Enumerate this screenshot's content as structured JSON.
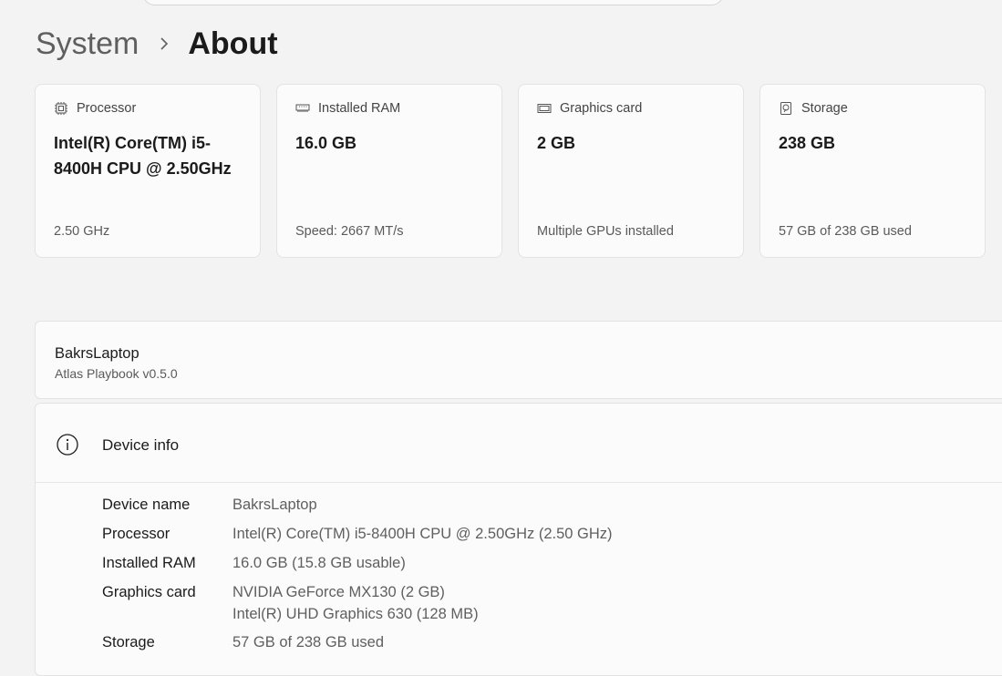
{
  "breadcrumb": {
    "parent": "System",
    "current": "About"
  },
  "cards": [
    {
      "label": "Processor",
      "value": "Intel(R) Core(TM) i5-8400H CPU @ 2.50GHz",
      "sub": "2.50 GHz",
      "icon": "processor-icon"
    },
    {
      "label": "Installed RAM",
      "value": "16.0 GB",
      "sub": "Speed: 2667 MT/s",
      "icon": "ram-icon"
    },
    {
      "label": "Graphics card",
      "value": "2 GB",
      "sub": "Multiple GPUs installed",
      "icon": "graphics-card-icon"
    },
    {
      "label": "Storage",
      "value": "238 GB",
      "sub": "57 GB of 238 GB used",
      "icon": "storage-icon"
    }
  ],
  "device": {
    "name": "BakrsLaptop",
    "edition": "Atlas Playbook v0.5.0"
  },
  "device_info": {
    "title": "Device info",
    "icon": "info-icon",
    "rows": [
      {
        "key": "Device name",
        "values": [
          "BakrsLaptop"
        ]
      },
      {
        "key": "Processor",
        "values": [
          "Intel(R) Core(TM) i5-8400H CPU @ 2.50GHz (2.50 GHz)"
        ]
      },
      {
        "key": "Installed RAM",
        "values": [
          "16.0 GB (15.8 GB usable)"
        ]
      },
      {
        "key": "Graphics card",
        "values": [
          "NVIDIA GeForce MX130 (2 GB)",
          "Intel(R) UHD Graphics 630 (128 MB)"
        ]
      },
      {
        "key": "Storage",
        "values": [
          "57 GB of 238 GB used"
        ]
      }
    ]
  }
}
